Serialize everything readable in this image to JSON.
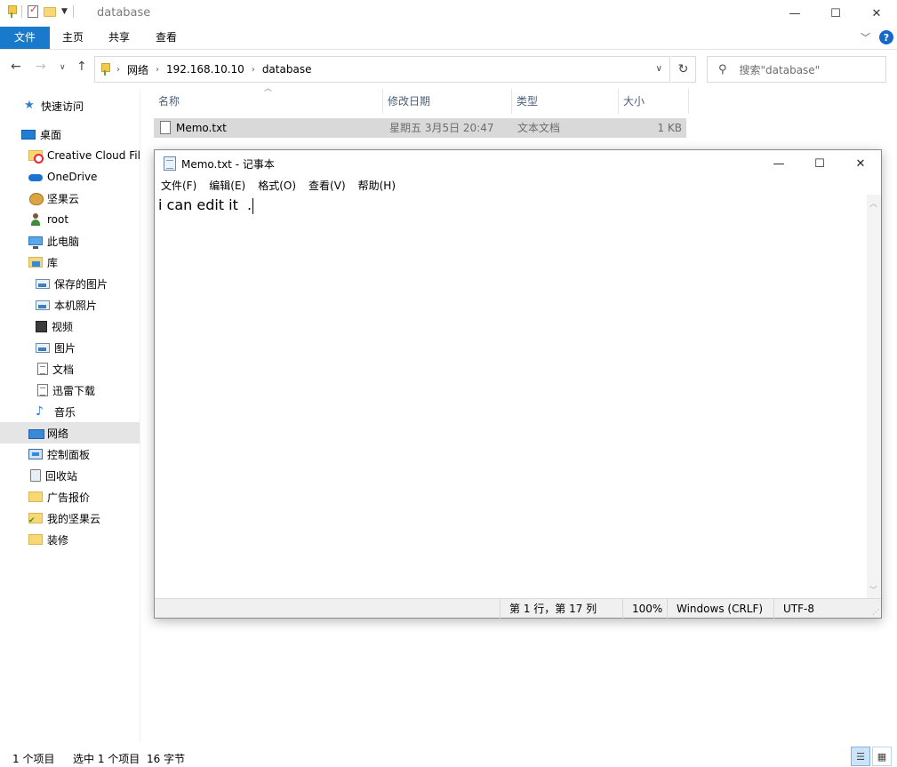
{
  "window": {
    "title": "database",
    "min_glyph": "—",
    "max_glyph": "☐",
    "close_glyph": "✕"
  },
  "ribbon": {
    "tabs": [
      {
        "label": "文件"
      },
      {
        "label": "主页"
      },
      {
        "label": "共享"
      },
      {
        "label": "查看"
      }
    ],
    "help_glyph": "?"
  },
  "address": {
    "crumbs": [
      "网络",
      "192.168.10.10",
      "database"
    ],
    "search_placeholder": "搜索\"database\""
  },
  "sidebar": {
    "items": [
      {
        "label": "快速访问",
        "icon": "star-icon"
      },
      {
        "label": "桌面",
        "icon": "desktop-icon"
      },
      {
        "label": "Creative Cloud Files",
        "icon": "creative-cloud-folder-icon"
      },
      {
        "label": "OneDrive",
        "icon": "onedrive-cloud-icon"
      },
      {
        "label": "坚果云",
        "icon": "nutstore-icon"
      },
      {
        "label": "root",
        "icon": "user-icon"
      },
      {
        "label": "此电脑",
        "icon": "pc-icon"
      },
      {
        "label": "库",
        "icon": "library-icon"
      },
      {
        "label": "保存的图片",
        "icon": "picture-library-icon"
      },
      {
        "label": "本机照片",
        "icon": "picture-library-icon"
      },
      {
        "label": "视频",
        "icon": "video-library-icon"
      },
      {
        "label": "图片",
        "icon": "picture-library-icon"
      },
      {
        "label": "文档",
        "icon": "document-library-icon"
      },
      {
        "label": "迅雷下载",
        "icon": "document-library-icon"
      },
      {
        "label": "音乐",
        "icon": "music-icon"
      },
      {
        "label": "网络",
        "icon": "network-icon",
        "selected": true
      },
      {
        "label": "控制面板",
        "icon": "control-panel-icon"
      },
      {
        "label": "回收站",
        "icon": "recycle-bin-icon"
      },
      {
        "label": "广告报价",
        "icon": "folder-icon"
      },
      {
        "label": "我的坚果云",
        "icon": "nutstore-folder-icon"
      },
      {
        "label": "装修",
        "icon": "folder-icon"
      }
    ]
  },
  "filelist": {
    "columns": [
      "名称",
      "修改日期",
      "类型",
      "大小"
    ],
    "rows": [
      {
        "name": "Memo.txt",
        "date": "星期五 3月5日 20:47",
        "type": "文本文档",
        "size": "1 KB"
      }
    ]
  },
  "statusbar": {
    "count": "1 个项目",
    "selected": "选中 1 个项目",
    "bytes": "16 字节"
  },
  "notepad": {
    "title": "Memo.txt - 记事本",
    "menu": [
      "文件(F)",
      "编辑(E)",
      "格式(O)",
      "查看(V)",
      "帮助(H)"
    ],
    "content": "i can edit it  .",
    "status": {
      "position": "第 1 行，第 17 列",
      "zoom": "100%",
      "line_ending": "Windows (CRLF)",
      "encoding": "UTF-8"
    }
  },
  "colors": {
    "accent": "#1979ca",
    "selection": "#d9d9d9"
  }
}
